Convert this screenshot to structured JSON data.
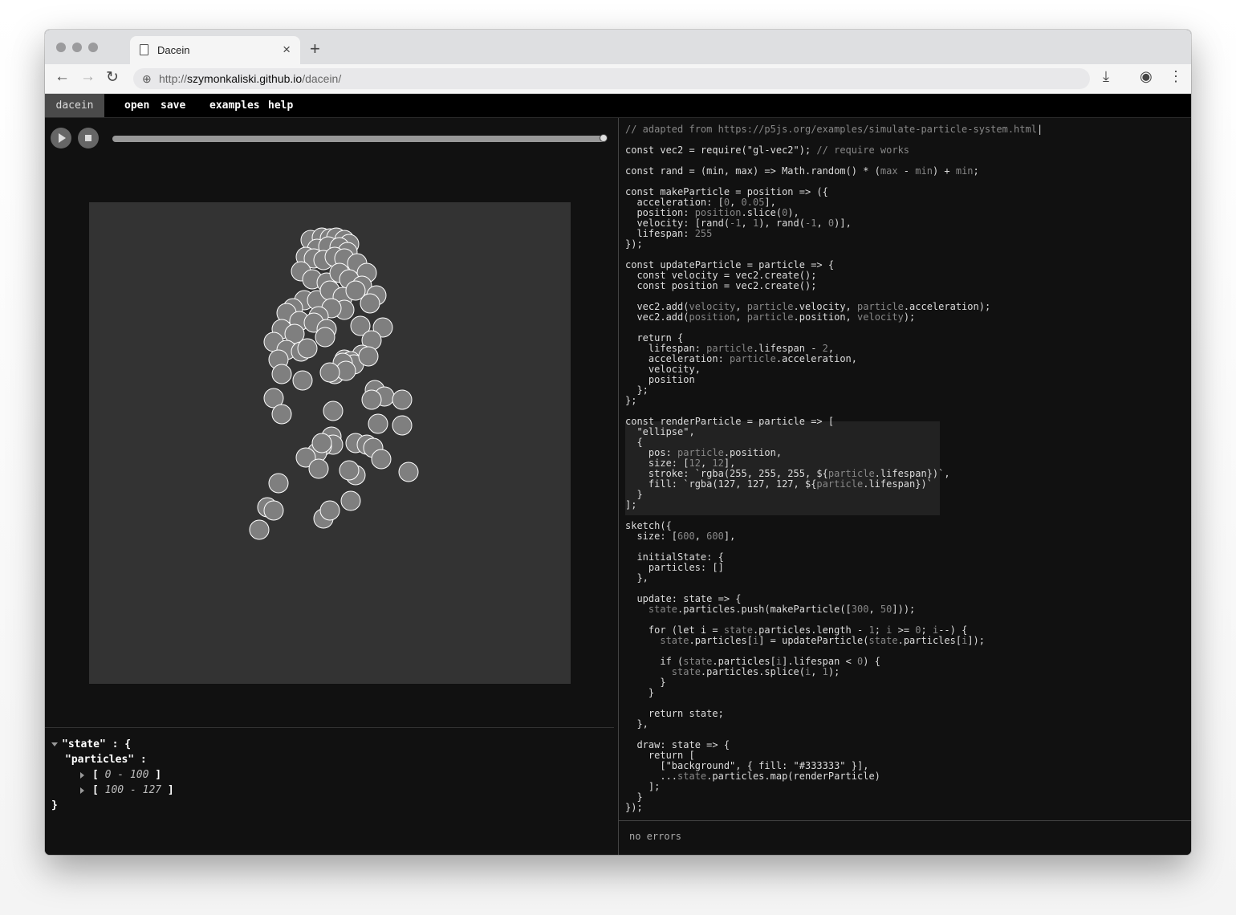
{
  "browser": {
    "tab_title": "Dacein",
    "url_prefix": "http://",
    "url_host": "szymonkaliski.github.io",
    "url_path": "/dacein/"
  },
  "menubar": {
    "brand": "dacein",
    "items": [
      "open",
      "save",
      "examples",
      "help"
    ]
  },
  "player": {
    "progress_fraction": 1.0
  },
  "canvas": {
    "background": "#333333",
    "particle_fill": "rgba(127,127,127)",
    "particle_stroke": "#ffffff"
  },
  "inspector": {
    "root": "\"state\" : {",
    "key": "\"particles\" :",
    "range1_start": "0",
    "range1_end": "100",
    "range2_start": "100",
    "range2_end": "127",
    "close": "}"
  },
  "editor": {
    "status": "no errors"
  }
}
